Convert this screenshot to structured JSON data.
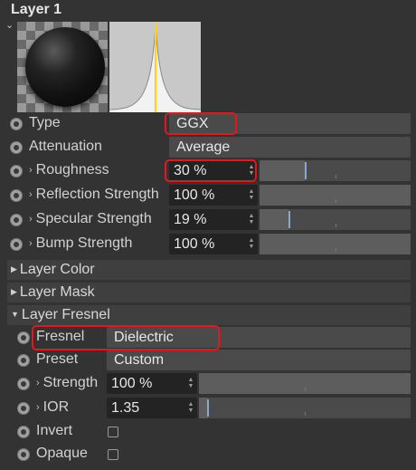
{
  "panel": {
    "title": "Layer 1",
    "preview": {
      "material": "black sphere",
      "curve": "specular lobe"
    }
  },
  "params": {
    "type": {
      "label": "Type",
      "value": "GGX"
    },
    "attenuation": {
      "label": "Attenuation",
      "value": "Average"
    },
    "roughness": {
      "label": "Roughness",
      "value": "30 %",
      "level": 0.3
    },
    "reflection_strength": {
      "label": "Reflection Strength",
      "value": "100 %",
      "level": 1.0
    },
    "specular_strength": {
      "label": "Specular Strength",
      "value": "19 %",
      "level": 0.19
    },
    "bump_strength": {
      "label": "Bump Strength",
      "value": "100 %",
      "level": 1.0
    }
  },
  "sections": {
    "layer_color": "Layer Color",
    "layer_mask": "Layer Mask",
    "layer_fresnel": "Layer Fresnel"
  },
  "fresnel": {
    "fresnel": {
      "label": "Fresnel",
      "value": "Dielectric"
    },
    "preset": {
      "label": "Preset",
      "value": "Custom"
    },
    "strength": {
      "label": "Strength",
      "value": "100 %",
      "level": 1.0
    },
    "ior": {
      "label": "IOR",
      "value": "1.35"
    },
    "invert": {
      "label": "Invert",
      "checked": false
    },
    "opaque": {
      "label": "Opaque",
      "checked": false
    }
  },
  "icons": {
    "collapse": "chevron-down-icon",
    "param_chevron": "chevron-right-icon",
    "section_toggle": "triangle-icon",
    "animate": "radio-dot-icon",
    "spinner": "up-down-arrows-icon"
  },
  "colors": {
    "highlight": "#e8151b",
    "slider_knob": "#8aa8d0",
    "panel_bg": "#333333"
  }
}
